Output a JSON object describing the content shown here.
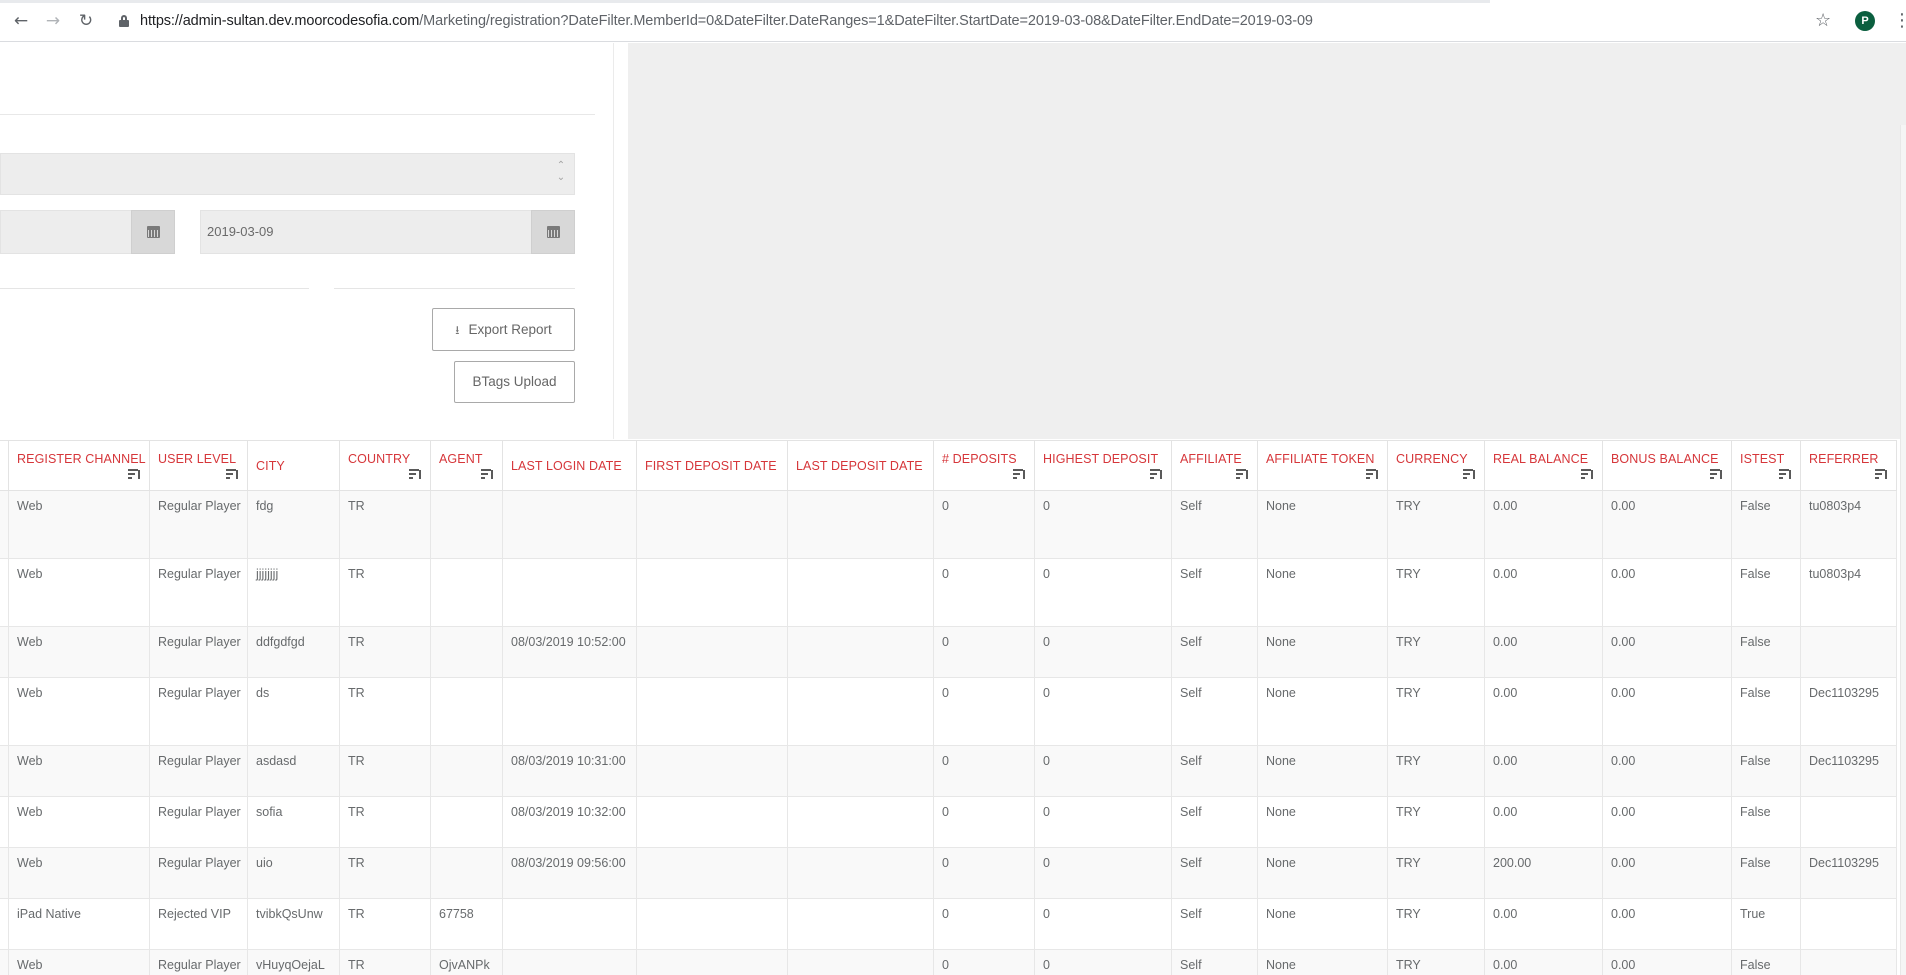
{
  "browser": {
    "url_host": "https://admin-sultan.dev.moorcodesofia.com",
    "url_rest": "/Marketing/registration?DateFilter.MemberId=0&DateFilter.DateRanges=1&DateFilter.StartDate=2019-03-08&DateFilter.EndDate=2019-03-09",
    "avatar_letter": "P",
    "back_icon": "←",
    "forward_icon": "→",
    "reload_icon": "↻",
    "star_icon": "☆",
    "menu_icon": "⋮"
  },
  "filters": {
    "end_date": "2019-03-09",
    "export_label": "Export Report",
    "btags_label": "BTags Upload"
  },
  "table": {
    "columns": [
      {
        "key": "register_channel",
        "label": "REGISTER CHANNEL",
        "filter": true
      },
      {
        "key": "user_level",
        "label": "USER LEVEL",
        "filter": true
      },
      {
        "key": "city",
        "label": "CITY",
        "filter": false
      },
      {
        "key": "country",
        "label": "COUNTRY",
        "filter": true
      },
      {
        "key": "agent",
        "label": "AGENT",
        "filter": true
      },
      {
        "key": "last_login_date",
        "label": "LAST LOGIN DATE",
        "filter": false
      },
      {
        "key": "first_deposit_date",
        "label": "FIRST DEPOSIT DATE",
        "filter": false
      },
      {
        "key": "last_deposit_date",
        "label": "LAST DEPOSIT DATE",
        "filter": false
      },
      {
        "key": "deposits",
        "label": "# DEPOSITS",
        "filter": true
      },
      {
        "key": "highest_deposit",
        "label": "HIGHEST DEPOSIT",
        "filter": true
      },
      {
        "key": "affiliate",
        "label": "AFFILIATE",
        "filter": true
      },
      {
        "key": "affiliate_token",
        "label": "AFFILIATE TOKEN",
        "filter": true
      },
      {
        "key": "currency",
        "label": "CURRENCY",
        "filter": true
      },
      {
        "key": "real_balance",
        "label": "REAL BALANCE",
        "filter": true
      },
      {
        "key": "bonus_balance",
        "label": "BONUS BALANCE",
        "filter": true
      },
      {
        "key": "istest",
        "label": "ISTEST",
        "filter": true
      },
      {
        "key": "referrer",
        "label": "REFERRER",
        "filter": true
      }
    ],
    "rows": [
      [
        "Web",
        "Regular Player",
        "fdg",
        "TR",
        "",
        "",
        "",
        "",
        "0",
        "0",
        "Self",
        "None",
        "TRY",
        "0.00",
        "0.00",
        "False",
        "tu0803p4"
      ],
      [
        "Web",
        "Regular Player",
        "jjjjjjjj",
        "TR",
        "",
        "",
        "",
        "",
        "0",
        "0",
        "Self",
        "None",
        "TRY",
        "0.00",
        "0.00",
        "False",
        "tu0803p4"
      ],
      [
        "Web",
        "Regular Player",
        "ddfgdfgd",
        "TR",
        "",
        "08/03/2019 10:52:00",
        "",
        "",
        "0",
        "0",
        "Self",
        "None",
        "TRY",
        "0.00",
        "0.00",
        "False",
        ""
      ],
      [
        "Web",
        "Regular Player",
        "ds",
        "TR",
        "",
        "",
        "",
        "",
        "0",
        "0",
        "Self",
        "None",
        "TRY",
        "0.00",
        "0.00",
        "False",
        "Dec1103295"
      ],
      [
        "Web",
        "Regular Player",
        "asdasd",
        "TR",
        "",
        "08/03/2019 10:31:00",
        "",
        "",
        "0",
        "0",
        "Self",
        "None",
        "TRY",
        "0.00",
        "0.00",
        "False",
        "Dec1103295"
      ],
      [
        "Web",
        "Regular Player",
        "sofia",
        "TR",
        "",
        "08/03/2019 10:32:00",
        "",
        "",
        "0",
        "0",
        "Self",
        "None",
        "TRY",
        "0.00",
        "0.00",
        "False",
        ""
      ],
      [
        "Web",
        "Regular Player",
        "uio",
        "TR",
        "",
        "08/03/2019 09:56:00",
        "",
        "",
        "0",
        "0",
        "Self",
        "None",
        "TRY",
        "200.00",
        "0.00",
        "False",
        "Dec1103295"
      ],
      [
        "iPad Native",
        "Rejected VIP",
        "tvibkQsUnw",
        "TR",
        "67758",
        "",
        "",
        "",
        "0",
        "0",
        "Self",
        "None",
        "TRY",
        "0.00",
        "0.00",
        "True",
        ""
      ],
      [
        "Web",
        "Regular Player",
        "vHuyqOejaL",
        "TR",
        "OjvANPk",
        "",
        "",
        "",
        "0",
        "0",
        "Self",
        "None",
        "TRY",
        "0.00",
        "0.00",
        "False",
        ""
      ]
    ]
  }
}
